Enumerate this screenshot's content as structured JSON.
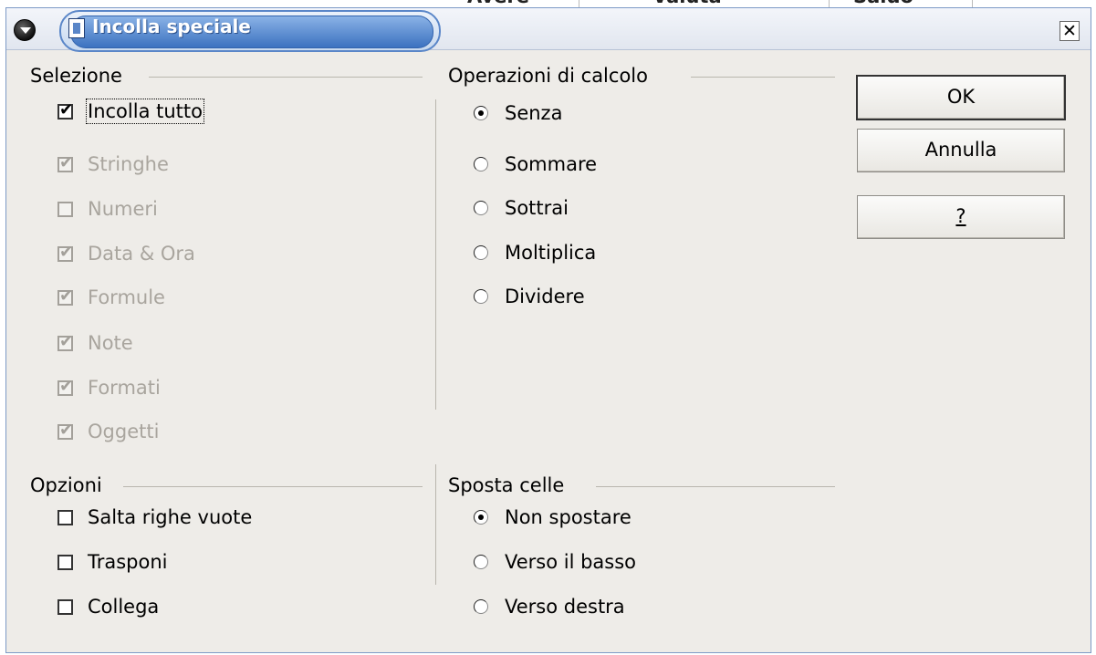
{
  "background": {
    "headers": [
      "Avere",
      "Valuta",
      "Saldo"
    ]
  },
  "dialog": {
    "title": "Incolla speciale",
    "icons": {
      "menu": "window-menu-icon",
      "title": "document-icon",
      "close": "close-icon"
    }
  },
  "selection": {
    "title": "Selezione",
    "items": [
      {
        "label": "Incolla tutto",
        "checked": true,
        "enabled": true
      },
      {
        "label": "Stringhe",
        "checked": true,
        "enabled": false
      },
      {
        "label": "Numeri",
        "checked": false,
        "enabled": false
      },
      {
        "label": "Data & Ora",
        "checked": true,
        "enabled": false
      },
      {
        "label": "Formule",
        "checked": true,
        "enabled": false
      },
      {
        "label": "Note",
        "checked": true,
        "enabled": false
      },
      {
        "label": "Formati",
        "checked": true,
        "enabled": false
      },
      {
        "label": "Oggetti",
        "checked": true,
        "enabled": false
      }
    ]
  },
  "operations": {
    "title": "Operazioni di calcolo",
    "selected": "Senza",
    "options": [
      "Senza",
      "Sommare",
      "Sottrai",
      "Moltiplica",
      "Dividere"
    ]
  },
  "options": {
    "title": "Opzioni",
    "items": [
      {
        "label": "Salta righe vuote",
        "checked": false
      },
      {
        "label": "Trasponi",
        "checked": false
      },
      {
        "label": "Collega",
        "checked": false
      }
    ]
  },
  "shift": {
    "title": "Sposta celle",
    "selected": "Non spostare",
    "options": [
      "Non spostare",
      "Verso il basso",
      "Verso destra"
    ]
  },
  "buttons": {
    "ok": "OK",
    "cancel": "Annulla",
    "help": "?"
  }
}
